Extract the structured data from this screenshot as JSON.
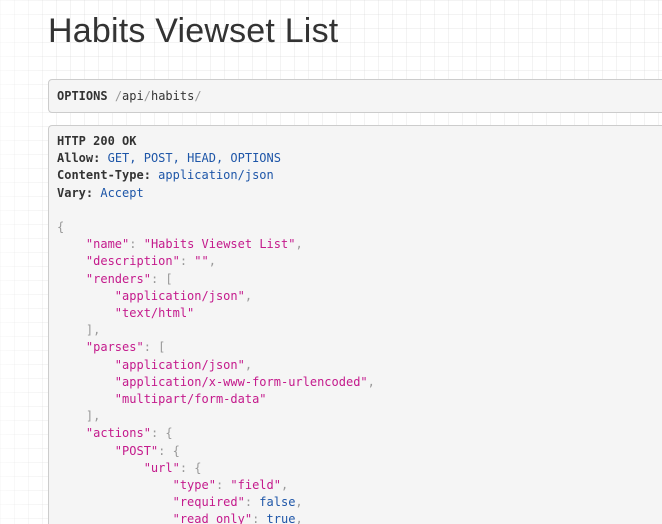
{
  "page": {
    "title": "Habits Viewset List"
  },
  "request": {
    "method": "OPTIONS",
    "path_segments": [
      "api",
      "habits"
    ]
  },
  "response": {
    "status_line": "HTTP 200 OK",
    "headers": [
      {
        "name": "Allow:",
        "value": "GET, POST, HEAD, OPTIONS"
      },
      {
        "name": "Content-Type:",
        "value": "application/json"
      },
      {
        "name": "Vary:",
        "value": "Accept"
      }
    ],
    "body": {
      "name_key": "\"name\"",
      "name_value": "\"Habits Viewset List\"",
      "description_key": "\"description\"",
      "description_value": "\"\"",
      "renders_key": "\"renders\"",
      "renders": [
        "\"application/json\"",
        "\"text/html\""
      ],
      "parses_key": "\"parses\"",
      "parses": [
        "\"application/json\"",
        "\"application/x-www-form-urlencoded\"",
        "\"multipart/form-data\""
      ],
      "actions_key": "\"actions\"",
      "post_key": "\"POST\"",
      "url_key": "\"url\"",
      "type_key": "\"type\"",
      "type_value": "\"field\"",
      "required_key": "\"required\"",
      "required_value": "false",
      "read_only_key": "\"read_only\"",
      "read_only_value": "true"
    }
  },
  "colors": {
    "keyword": "#1e56a8",
    "string": "#c41a8c",
    "punctuation": "#999999",
    "panel_background": "#f5f5f5"
  }
}
